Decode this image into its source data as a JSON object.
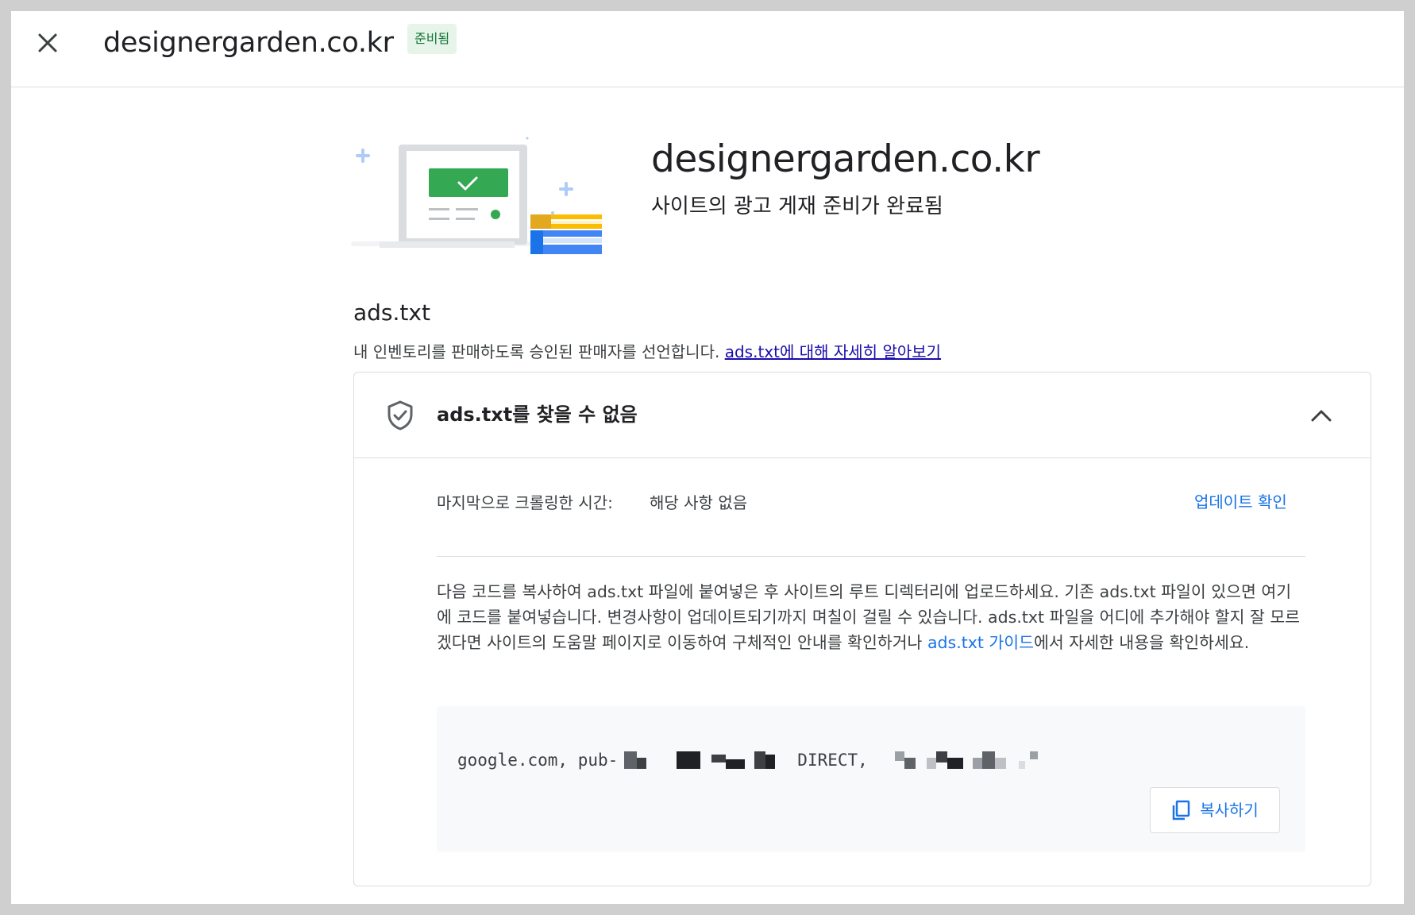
{
  "header": {
    "title": "designergarden.co.kr",
    "status": "준비됨"
  },
  "hero": {
    "site": "designergarden.co.kr",
    "status_message": "사이트의 광고 게재 준비가 완료됨"
  },
  "ads_txt": {
    "title": "ads.txt",
    "description": "내 인벤토리를 판매하도록 승인된 판매자를 선언합니다.",
    "learn_more": "ads.txt에 대해 자세히 알아보기",
    "panel": {
      "title": "ads.txt를 찾을 수 없음",
      "last_crawl_label": "마지막으로 크롤링한 시간:",
      "last_crawl_value": "해당 사항 없음",
      "check_update": "업데이트 확인",
      "instructions_before": "다음 코드를 복사하여 ads.txt 파일에 붙여넣은 후 사이트의 루트 디렉터리에 업로드하세요. 기존 ads.txt 파일이 있으면 여기에 코드를 붙여넣습니다. 변경사항이 업데이트되기까지 며칠이 걸릴 수 있습니다. ads.txt 파일을 어디에 추가해야 할지 잘 모르겠다면 사이트의 도움말 페이지로 이동하여 구체적인 안내를 확인하거나 ",
      "guide_link": "ads.txt 가이드",
      "instructions_after": "에서 자세한 내용을 확인하세요.",
      "code_prefix": "google.com, pub-",
      "code_middle": "DIRECT,",
      "copy_label": "복사하기"
    }
  },
  "colors": {
    "link": "#1a73e8",
    "chip_bg": "#e6f4ea",
    "chip_text": "#137333",
    "check_green": "#34a853"
  },
  "icons": {
    "close": "close-icon",
    "shield": "shield-check-icon",
    "chevron": "chevron-up-icon",
    "copy": "copy-icon"
  }
}
